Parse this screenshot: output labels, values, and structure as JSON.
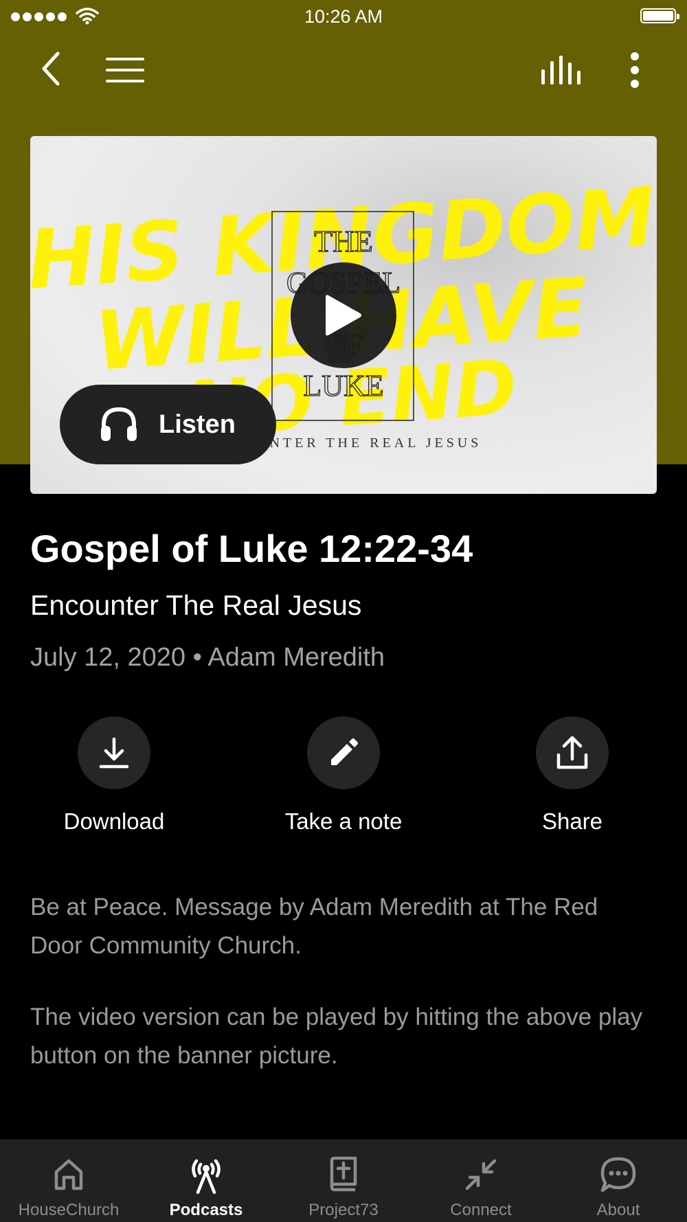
{
  "status_bar": {
    "time": "10:26 AM"
  },
  "banner": {
    "headline_line1": "HIS KINGDOM",
    "headline_line2": "WILL HAVE",
    "headline_line3": "NO END",
    "book_line1": "THE",
    "book_line2": "GOSPEL",
    "book_line3": "OF",
    "book_line4": "LUKE",
    "subtitle": "ENCOUNTER THE REAL JESUS",
    "listen_label": "Listen",
    "accent_color": "#fff200"
  },
  "message": {
    "title": "Gospel of Luke 12:22-34",
    "series": "Encounter The Real Jesus",
    "meta": "July 12, 2020 • Adam Meredith"
  },
  "actions": [
    {
      "label": "Download",
      "icon": "download-icon"
    },
    {
      "label": "Take a note",
      "icon": "pencil-icon"
    },
    {
      "label": "Share",
      "icon": "share-icon"
    }
  ],
  "description": [
    "Be at Peace. Message by Adam Meredith at The Red Door Community Church.",
    "The video version can be played by hitting the above play button on the banner picture."
  ],
  "tabs": [
    {
      "label": "HouseChurch",
      "icon": "home-icon",
      "active": false
    },
    {
      "label": "Podcasts",
      "icon": "podcast-icon",
      "active": true
    },
    {
      "label": "Project73",
      "icon": "bible-icon",
      "active": false
    },
    {
      "label": "Connect",
      "icon": "connect-icon",
      "active": false
    },
    {
      "label": "About",
      "icon": "chat-icon",
      "active": false
    }
  ],
  "colors": {
    "header": "#656004",
    "background": "#000000",
    "tab_bar": "#212121"
  }
}
